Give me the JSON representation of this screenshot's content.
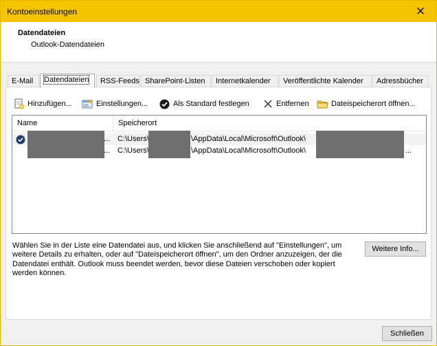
{
  "window": {
    "title": "Kontoeinstellungen",
    "close_glyph": "✕"
  },
  "header": {
    "title": "Datendateien",
    "subtitle": "Outlook-Datendateien"
  },
  "tabs": [
    {
      "label": "E-Mail"
    },
    {
      "label": "Datendateien",
      "active": true
    },
    {
      "label": "RSS-Feeds"
    },
    {
      "label": "SharePoint-Listen"
    },
    {
      "label": "Internetkalender"
    },
    {
      "label": "Veröffentlichte Kalender"
    },
    {
      "label": "Adressbücher"
    }
  ],
  "toolbar": {
    "add": {
      "label": "Hinzufügen...",
      "icon": "add-datafile-icon"
    },
    "settings": {
      "label": "Einstellungen...",
      "icon": "datafile-settings-icon"
    },
    "set_default": {
      "label": "Als Standard festlegen",
      "icon": "checkmark-circle-icon"
    },
    "remove": {
      "label": "Entfernen",
      "icon": "x-icon"
    },
    "open_location": {
      "label": "Dateispeicherort öffnen...",
      "icon": "folder-icon"
    }
  },
  "list": {
    "columns": [
      "Name",
      "Speicherort"
    ],
    "rows": [
      {
        "name_suffix": "...",
        "path_prefix": "C:\\Users\\",
        "path_middle": "\\AppData\\Local\\Microsoft\\Outlook\\",
        "path_suffix": "",
        "is_default": true
      },
      {
        "name_suffix": "...",
        "path_prefix": "C:\\Users\\",
        "path_middle": "\\AppData\\Local\\Microsoft\\Outlook\\",
        "path_suffix": "...",
        "is_default": false
      }
    ]
  },
  "description": "Wählen Sie in der Liste eine Datendatei aus, und klicken Sie anschließend auf \"Einstellungen\", um weitere Details zu erhalten, oder auf \"Dateispeicherort öffnen\", um den Ordner anzuzeigen, der die Datendatei enthält. Outlook muss beendet werden, bevor diese Dateien verschoben oder kopiert werden können.",
  "buttons": {
    "more_info": "Weitere Info...",
    "close": "Schließen"
  },
  "colors": {
    "titlebar": "#f5c400",
    "redaction": "#6f6f6f",
    "default_icon": "#1f3d73"
  }
}
